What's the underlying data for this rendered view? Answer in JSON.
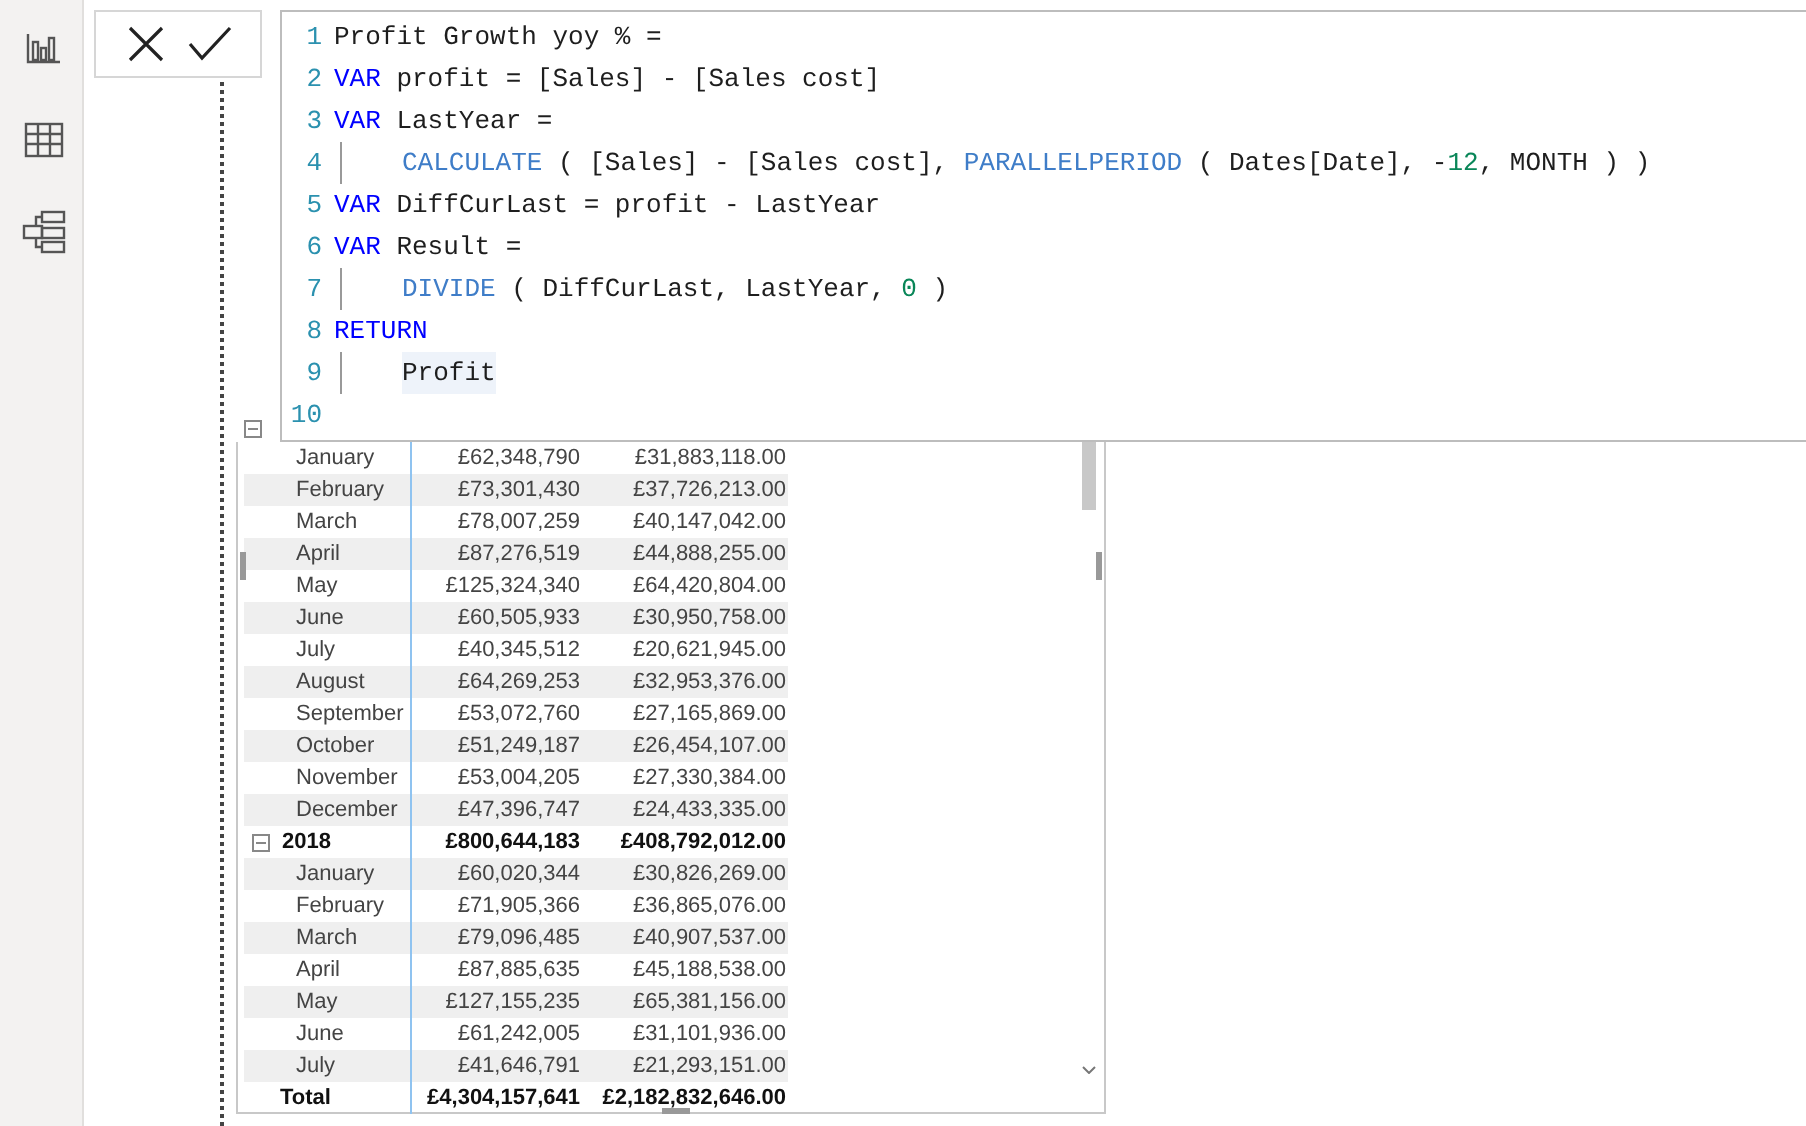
{
  "sidebar": {
    "items": [
      {
        "kind": "report"
      },
      {
        "kind": "data"
      },
      {
        "kind": "model"
      }
    ]
  },
  "formula_bar": {
    "lines": [
      {
        "number": "1",
        "indent": false,
        "tokens": [
          {
            "kind": "plain",
            "text": "Profit Growth yoy % ="
          }
        ]
      },
      {
        "number": "2",
        "indent": false,
        "tokens": [
          {
            "kind": "keyword",
            "text": "VAR"
          },
          {
            "kind": "plain",
            "text": " profit = [Sales] - [Sales cost]"
          }
        ]
      },
      {
        "number": "3",
        "indent": false,
        "tokens": [
          {
            "kind": "keyword",
            "text": "VAR"
          },
          {
            "kind": "plain",
            "text": " LastYear ="
          }
        ]
      },
      {
        "number": "4",
        "indent": true,
        "tokens": [
          {
            "kind": "function",
            "text": "CALCULATE"
          },
          {
            "kind": "plain",
            "text": " ( [Sales] - [Sales cost], "
          },
          {
            "kind": "function",
            "text": "PARALLELPERIOD"
          },
          {
            "kind": "plain",
            "text": " ( Dates[Date], -"
          },
          {
            "kind": "number",
            "text": "12"
          },
          {
            "kind": "plain",
            "text": ", MONTH ) )"
          }
        ]
      },
      {
        "number": "5",
        "indent": false,
        "tokens": [
          {
            "kind": "keyword",
            "text": "VAR"
          },
          {
            "kind": "plain",
            "text": " DiffCurLast = profit - LastYear"
          }
        ]
      },
      {
        "number": "6",
        "indent": false,
        "tokens": [
          {
            "kind": "keyword",
            "text": "VAR"
          },
          {
            "kind": "plain",
            "text": " Result ="
          }
        ]
      },
      {
        "number": "7",
        "indent": true,
        "tokens": [
          {
            "kind": "function",
            "text": "DIVIDE"
          },
          {
            "kind": "plain",
            "text": " ( DiffCurLast, LastYear, "
          },
          {
            "kind": "number",
            "text": "0"
          },
          {
            "kind": "plain",
            "text": " )"
          }
        ]
      },
      {
        "number": "8",
        "indent": false,
        "tokens": [
          {
            "kind": "keyword",
            "text": "RETURN"
          }
        ]
      },
      {
        "number": "9",
        "indent": true,
        "tokens": [
          {
            "kind": "highlight",
            "text": "Profit"
          }
        ]
      },
      {
        "number": "10",
        "indent": false
      }
    ]
  },
  "table": {
    "rows": [
      {
        "kind": "month",
        "label": "January",
        "column_2": "£62,348,790",
        "column_3": "£31,883,118.00"
      },
      {
        "kind": "month",
        "label": "February",
        "column_2": "£73,301,430",
        "column_3": "£37,726,213.00"
      },
      {
        "kind": "month",
        "label": "March",
        "column_2": "£78,007,259",
        "column_3": "£40,147,042.00"
      },
      {
        "kind": "month",
        "label": "April",
        "column_2": "£87,276,519",
        "column_3": "£44,888,255.00"
      },
      {
        "kind": "month",
        "label": "May",
        "column_2": "£125,324,340",
        "column_3": "£64,420,804.00"
      },
      {
        "kind": "month",
        "label": "June",
        "column_2": "£60,505,933",
        "column_3": "£30,950,758.00"
      },
      {
        "kind": "month",
        "label": "July",
        "column_2": "£40,345,512",
        "column_3": "£20,621,945.00"
      },
      {
        "kind": "month",
        "label": "August",
        "column_2": "£64,269,253",
        "column_3": "£32,953,376.00"
      },
      {
        "kind": "month",
        "label": "September",
        "column_2": "£53,072,760",
        "column_3": "£27,165,869.00"
      },
      {
        "kind": "month",
        "label": "October",
        "column_2": "£51,249,187",
        "column_3": "£26,454,107.00"
      },
      {
        "kind": "month",
        "label": "November",
        "column_2": "£53,004,205",
        "column_3": "£27,330,384.00"
      },
      {
        "kind": "month",
        "label": "December",
        "column_2": "£47,396,747",
        "column_3": "£24,433,335.00"
      },
      {
        "kind": "year",
        "label": "2018",
        "column_2": "£800,644,183",
        "column_3": "£408,792,012.00"
      },
      {
        "kind": "month",
        "label": "January",
        "column_2": "£60,020,344",
        "column_3": "£30,826,269.00"
      },
      {
        "kind": "month",
        "label": "February",
        "column_2": "£71,905,366",
        "column_3": "£36,865,076.00"
      },
      {
        "kind": "month",
        "label": "March",
        "column_2": "£79,096,485",
        "column_3": "£40,907,537.00"
      },
      {
        "kind": "month",
        "label": "April",
        "column_2": "£87,885,635",
        "column_3": "£45,188,538.00"
      },
      {
        "kind": "month",
        "label": "May",
        "column_2": "£127,155,235",
        "column_3": "£65,381,156.00"
      },
      {
        "kind": "month",
        "label": "June",
        "column_2": "£61,242,005",
        "column_3": "£31,101,936.00"
      },
      {
        "kind": "month",
        "label": "July",
        "column_2": "£41,646,791",
        "column_3": "£21,293,151.00"
      },
      {
        "kind": "total",
        "label": "Total",
        "column_2": "£4,304,157,641",
        "column_3": "£2,182,832,646.00"
      }
    ]
  }
}
